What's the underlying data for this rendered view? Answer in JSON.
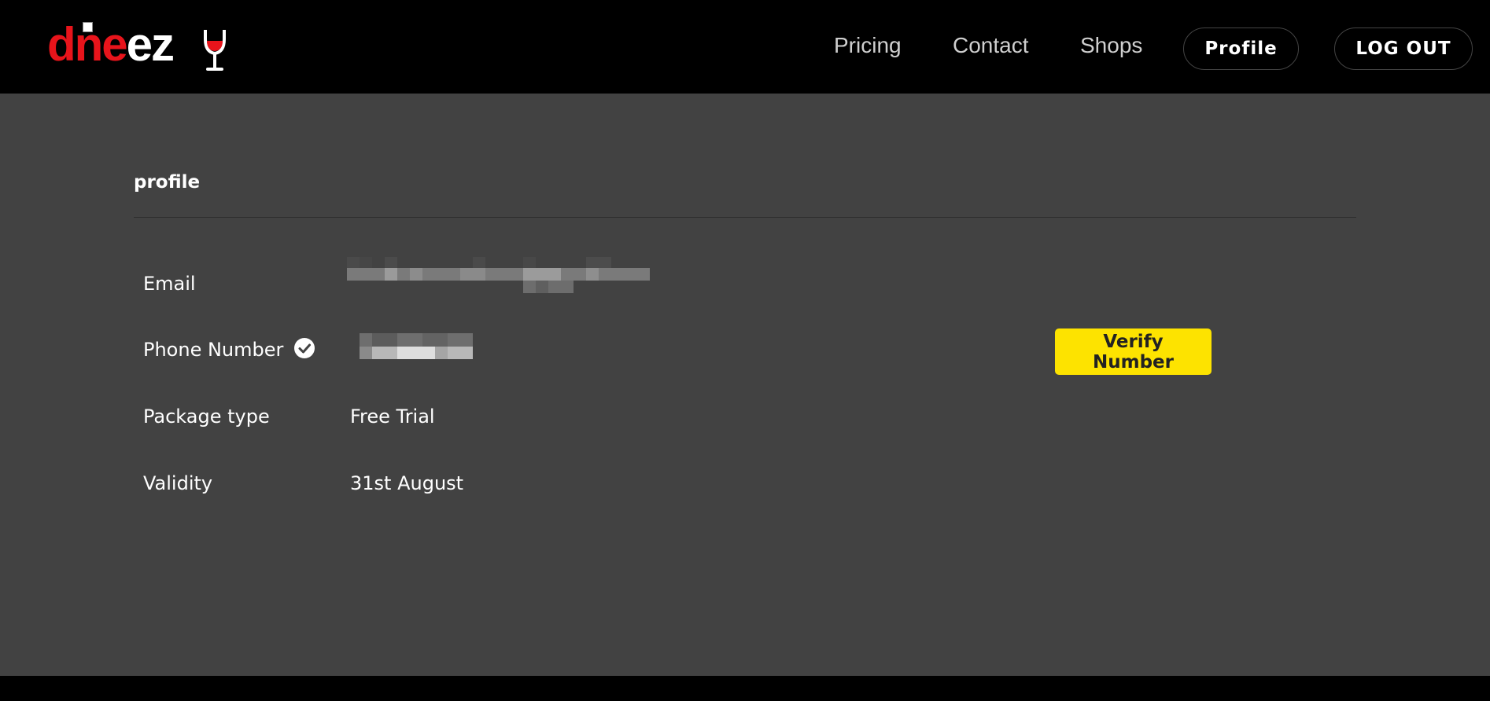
{
  "brand": {
    "logo_text_part1": "dne",
    "logo_text_part2": "ez",
    "accent_color": "#e8141b",
    "logo_icon": "wine-glass-icon"
  },
  "nav": {
    "links": [
      {
        "label": "Pricing"
      },
      {
        "label": "Contact"
      },
      {
        "label": "Shops"
      }
    ],
    "profile_label": "Profile",
    "logout_label": "LOG OUT"
  },
  "profile": {
    "title": "profile",
    "fields": [
      {
        "label": "Email",
        "value": ""
      },
      {
        "label": "Phone Number",
        "value": "",
        "verified_icon": "check-circle-icon"
      },
      {
        "label": "Package type",
        "value": "Free Trial"
      },
      {
        "label": "Validity",
        "value": "31st August"
      }
    ],
    "verify_button_label": "Verify Number",
    "verify_button_color": "#fde300"
  }
}
